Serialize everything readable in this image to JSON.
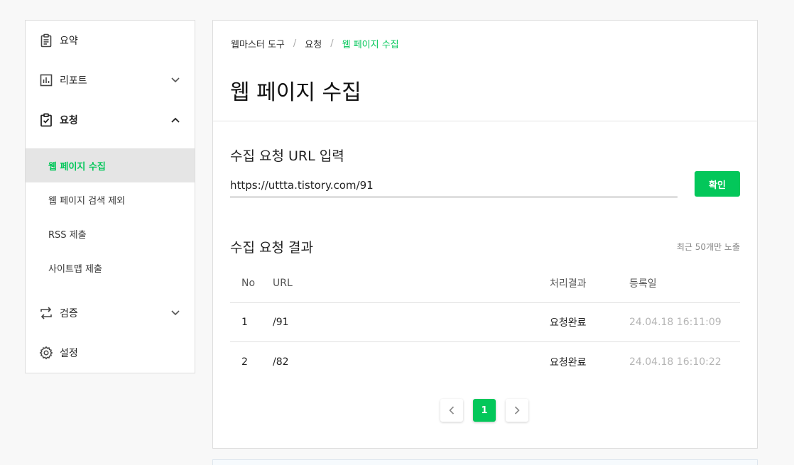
{
  "sidebar": {
    "items": [
      {
        "label": "요약",
        "icon": "clipboard-icon"
      },
      {
        "label": "리포트",
        "icon": "bar-chart-icon"
      },
      {
        "label": "요청",
        "icon": "clipboard-check-icon"
      },
      {
        "label": "검증",
        "icon": "repeat-icon"
      },
      {
        "label": "설정",
        "icon": "gear-icon"
      }
    ],
    "sub_items": [
      {
        "label": "웹 페이지 수집"
      },
      {
        "label": "웹 페이지 검색 제외"
      },
      {
        "label": "RSS 제출"
      },
      {
        "label": "사이트맵 제출"
      }
    ]
  },
  "breadcrumb": {
    "items": [
      "웹마스터 도구",
      "요청",
      "웹 페이지 수집"
    ],
    "separator": "/"
  },
  "page_title": "웹 페이지 수집",
  "request_section": {
    "title": "수집 요청 URL 입력",
    "input_value": "https://uttta.tistory.com/91",
    "confirm_label": "확인"
  },
  "result_section": {
    "title": "수집 요청 결과",
    "note": "최근 50개만 노출",
    "columns": [
      "No",
      "URL",
      "처리결과",
      "등록일"
    ],
    "rows": [
      {
        "no": "1",
        "url": "/91",
        "result": "요청완료",
        "date": "24.04.18 16:11:09"
      },
      {
        "no": "2",
        "url": "/82",
        "result": "요청완료",
        "date": "24.04.18 16:10:22"
      }
    ]
  },
  "pagination": {
    "current_page": "1"
  },
  "colors": {
    "accent": "#03c75a",
    "active_bg": "#e5e5e5",
    "date_text": "#b5b5b5"
  }
}
